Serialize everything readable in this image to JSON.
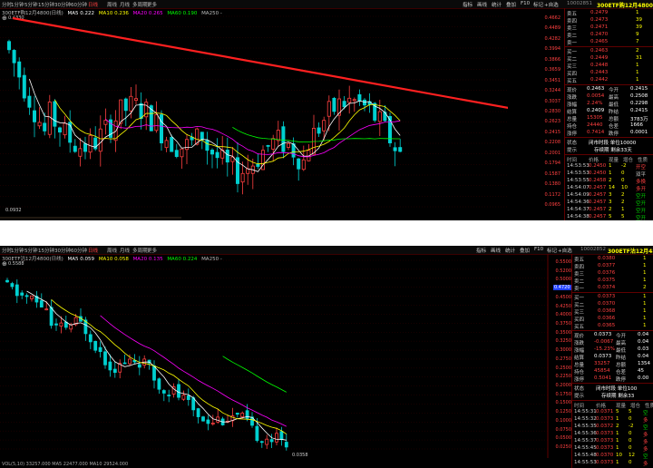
{
  "colors": {
    "up": "#ff4040",
    "down": "#00d0d0",
    "flat": "#c8c8c8",
    "ma5": "#ffffff",
    "ma10": "#ffff00",
    "ma20": "#ff00ff",
    "ma60": "#00ff00",
    "arrow": "#ff2020"
  },
  "tabs": [
    "分时",
    "1分钟",
    "5分钟",
    "15分钟",
    "30分钟",
    "60分钟",
    "日线",
    "周线",
    "月线",
    "多周期",
    "更多"
  ],
  "menu": [
    "指标",
    "画线",
    "统计",
    "叠加",
    "F10",
    "标记",
    "+自选"
  ],
  "icons": [
    "close-icon"
  ],
  "pane1": {
    "code": "10002851",
    "title": "300ETF购12月4800",
    "ma_caption": "300ETF购12月4800(日线)",
    "ma5": "MA5 0.222",
    "ma10": "MA10 0.236",
    "ma20": "MA20 0.265",
    "ma60": "MA60 0.190",
    "ma250": "MA250 -",
    "max_label": "0.4330",
    "min_label": "0.0932",
    "axis": [
      "0.4662",
      "0.4489",
      "0.4282",
      "0.3994",
      "0.3866",
      "0.3659",
      "0.3451",
      "0.3244",
      "0.3037",
      "0.2830",
      "0.2623",
      "0.2415",
      "0.2208",
      "0.2001",
      "0.1794",
      "0.1587",
      "0.1380",
      "0.1172",
      "0.0965"
    ],
    "sell": [
      [
        "卖五",
        "0.2479",
        "1"
      ],
      [
        "卖四",
        "0.2473",
        "39"
      ],
      [
        "卖三",
        "0.2471",
        "39"
      ],
      [
        "卖二",
        "0.2470",
        "9"
      ],
      [
        "卖一",
        "0.2465",
        "7"
      ]
    ],
    "buy": [
      [
        "买一",
        "0.2463",
        "2"
      ],
      [
        "买二",
        "0.2449",
        "31"
      ],
      [
        "买三",
        "0.2448",
        "1"
      ],
      [
        "买四",
        "0.2443",
        "1"
      ],
      [
        "买五",
        "0.2442",
        "1"
      ]
    ],
    "quote": [
      [
        "现价",
        "0.2463",
        "今开",
        "0.2415"
      ],
      [
        "涨跌",
        "0.0054",
        "最高",
        "0.2508"
      ],
      [
        "涨幅",
        "2.24%",
        "最低",
        "0.2298"
      ],
      [
        "结算",
        "0.2409",
        "昨结",
        "0.2415"
      ],
      [
        "总量",
        "15305",
        "总额",
        "3783万"
      ],
      [
        "持仓",
        "24440",
        "仓差",
        "1666"
      ],
      [
        "涨停",
        "0.7414",
        "跌停",
        "0.0001"
      ]
    ],
    "status": [
      "状态",
      "闭市时段 单位10000",
      "提示",
      "存续期 剩余33天"
    ],
    "ticks": [
      [
        "14:53:53",
        "0.2450",
        "1",
        "-2",
        "开空"
      ],
      [
        "14:53:53",
        "0.2450",
        "1",
        "0",
        "双平"
      ],
      [
        "14:53:55",
        "0.2458",
        "2",
        "0",
        "多换"
      ],
      [
        "14:54:07",
        "0.2457",
        "14",
        "10",
        "多开"
      ],
      [
        "14:54:09",
        "0.2457",
        "3",
        "2",
        "空开"
      ],
      [
        "14:54:36",
        "0.2457",
        "3",
        "2",
        "空开"
      ],
      [
        "14:54:37",
        "0.2457",
        "2",
        "1",
        "空开"
      ],
      [
        "14:54:38",
        "0.2457",
        "5",
        "5",
        "空开"
      ],
      [
        "14:55:00",
        "0.2463",
        "39",
        "13",
        "空开"
      ]
    ]
  },
  "pane2": {
    "code": "10002852",
    "title": "300ETF沽12月4800",
    "ma_caption": "300ETF沽12月4800(日线)",
    "ma5": "MA5 0.059",
    "ma10": "MA10 0.058",
    "ma20": "MA20 0.135",
    "ma60": "MA60 0.224",
    "ma250": "MA250 -",
    "max_label": "0.5588",
    "min_label": "0.0358",
    "cursor_label": "0.4720",
    "axis": [
      "0.5500",
      "0.5200",
      "0.5000",
      "0.4720",
      "0.4500",
      "0.4250",
      "0.4000",
      "0.3750",
      "0.3500",
      "0.3250",
      "0.3000",
      "0.2750",
      "0.2500",
      "0.2250",
      "0.2000",
      "0.1750",
      "0.1500",
      "0.1250",
      "0.1000",
      "0.0750",
      "0.0500",
      "0.0250"
    ],
    "sell": [
      [
        "卖五",
        "0.0380",
        "1"
      ],
      [
        "卖四",
        "0.0377",
        "1"
      ],
      [
        "卖三",
        "0.0376",
        "1"
      ],
      [
        "卖二",
        "0.0375",
        "1"
      ],
      [
        "卖一",
        "0.0374",
        "2"
      ]
    ],
    "buy": [
      [
        "买一",
        "0.0373",
        "1"
      ],
      [
        "买二",
        "0.0370",
        "1"
      ],
      [
        "买三",
        "0.0368",
        "1"
      ],
      [
        "买四",
        "0.0366",
        "1"
      ],
      [
        "买五",
        "0.0365",
        "1"
      ]
    ],
    "quote": [
      [
        "现价",
        "0.0373",
        "今开",
        "0.04"
      ],
      [
        "涨跌",
        "-0.0067",
        "最高",
        "0.04"
      ],
      [
        "涨幅",
        "-15.23%",
        "最低",
        "0.03"
      ],
      [
        "结算",
        "0.0373",
        "昨结",
        "0.04"
      ],
      [
        "总量",
        "33257",
        "总额",
        "1354"
      ],
      [
        "持仓",
        "45854",
        "仓差",
        "45"
      ],
      [
        "涨停",
        "0.5041",
        "跌停",
        "0.00"
      ]
    ],
    "status": [
      "状态",
      "闭市时段 单位100",
      "提示",
      "存续期 剩余33"
    ],
    "ticks": [
      [
        "14:55:31",
        "0.0371",
        "5",
        "5",
        "空"
      ],
      [
        "14:55:32",
        "0.0373",
        "1",
        "0",
        "多"
      ],
      [
        "14:55:35",
        "0.0372",
        "2",
        "-2",
        "空"
      ],
      [
        "14:55:36",
        "0.0373",
        "1",
        "0",
        "多"
      ],
      [
        "14:55:37",
        "0.0373",
        "1",
        "0",
        "多"
      ],
      [
        "14:55:45",
        "0.0373",
        "1",
        "0",
        "多"
      ],
      [
        "14:55:48",
        "0.0370",
        "10",
        "12",
        "空"
      ],
      [
        "14:55:53",
        "0.0373",
        "1",
        "0",
        "多"
      ]
    ],
    "vol_caption": "VOL(5,10) 33257.000 MA5 22477.000 MA10 29524.000"
  }
}
